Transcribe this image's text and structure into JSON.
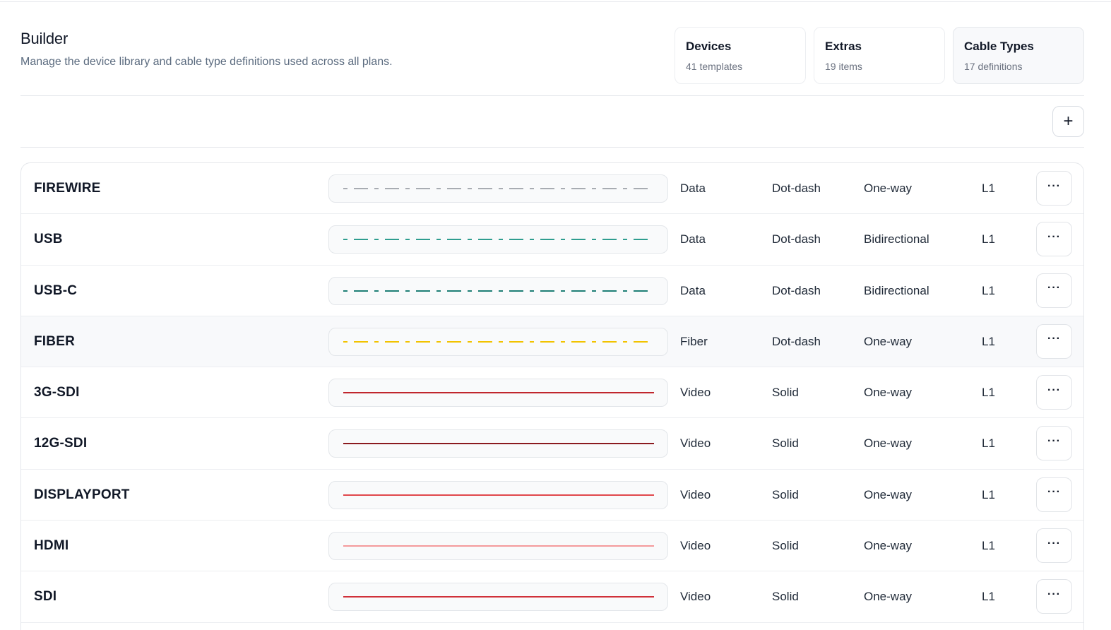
{
  "header": {
    "title": "Builder",
    "subtitle": "Manage the device library and cable type definitions used across all plans."
  },
  "stats": [
    {
      "label": "Devices",
      "value": "41 templates",
      "active": false
    },
    {
      "label": "Extras",
      "value": "19 items",
      "active": false
    },
    {
      "label": "Cable Types",
      "value": "17 definitions",
      "active": true
    }
  ],
  "toolbar": {
    "add_label": "+"
  },
  "cables": [
    {
      "name": "FIREWIRE",
      "category": "Data",
      "style": "Dot-dash",
      "direction": "One-way",
      "level": "L1",
      "color": "#a8acb2",
      "dashed": true,
      "highlight": false
    },
    {
      "name": "USB",
      "category": "Data",
      "style": "Dot-dash",
      "direction": "Bidirectional",
      "level": "L1",
      "color": "#2f9d8f",
      "dashed": true,
      "highlight": false
    },
    {
      "name": "USB-C",
      "category": "Data",
      "style": "Dot-dash",
      "direction": "Bidirectional",
      "level": "L1",
      "color": "#1f7f76",
      "dashed": true,
      "highlight": false
    },
    {
      "name": "FIBER",
      "category": "Fiber",
      "style": "Dot-dash",
      "direction": "One-way",
      "level": "L1",
      "color": "#f2c300",
      "dashed": true,
      "highlight": true
    },
    {
      "name": "3G-SDI",
      "category": "Video",
      "style": "Solid",
      "direction": "One-way",
      "level": "L1",
      "color": "#c0262d",
      "dashed": false,
      "highlight": false
    },
    {
      "name": "12G-SDI",
      "category": "Video",
      "style": "Solid",
      "direction": "One-way",
      "level": "L1",
      "color": "#8b1a1f",
      "dashed": false,
      "highlight": false
    },
    {
      "name": "DISPLAYPORT",
      "category": "Video",
      "style": "Solid",
      "direction": "One-way",
      "level": "L1",
      "color": "#e0474c",
      "dashed": false,
      "highlight": false
    },
    {
      "name": "HDMI",
      "category": "Video",
      "style": "Solid",
      "direction": "One-way",
      "level": "L1",
      "color": "#f49a9c",
      "dashed": false,
      "highlight": false
    },
    {
      "name": "SDI",
      "category": "Video",
      "style": "Solid",
      "direction": "One-way",
      "level": "L1",
      "color": "#d0303a",
      "dashed": false,
      "highlight": false
    }
  ],
  "row_action_label": "···"
}
